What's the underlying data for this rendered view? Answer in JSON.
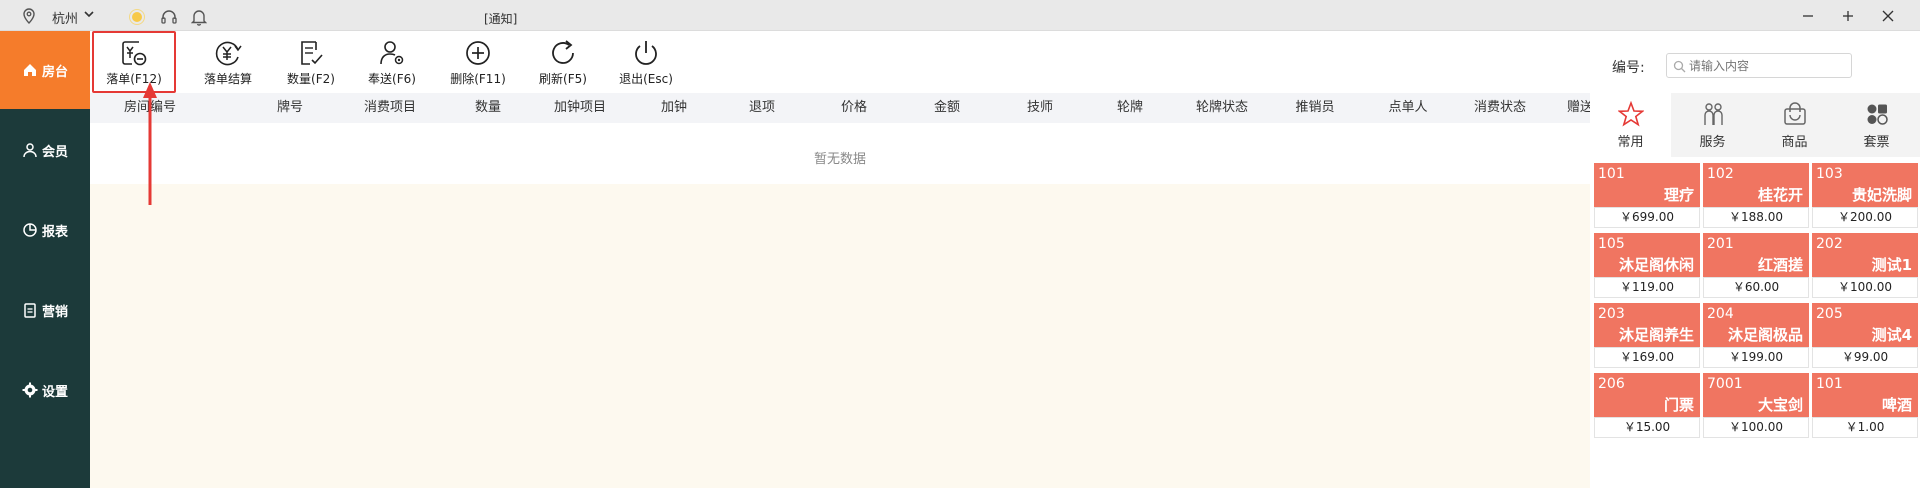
{
  "titlebar": {
    "city": "杭州",
    "notice": "[通知]"
  },
  "sidebar": {
    "items": [
      {
        "label": "房台",
        "icon": "home-icon",
        "active": true
      },
      {
        "label": "会员",
        "icon": "user-icon",
        "active": false
      },
      {
        "label": "报表",
        "icon": "pie-chart-icon",
        "active": false
      },
      {
        "label": "营销",
        "icon": "clipboard-icon",
        "active": false
      },
      {
        "label": "设置",
        "icon": "gear-icon",
        "active": false
      }
    ]
  },
  "toolbar": {
    "buttons": [
      {
        "label": "落单(F12)",
        "icon": "yen-minus-icon",
        "selected": true
      },
      {
        "label": "落单结算",
        "icon": "yen-refresh-icon",
        "selected": false
      },
      {
        "label": "数量(F2)",
        "icon": "edit-doc-icon",
        "selected": false
      },
      {
        "label": "奉送(F6)",
        "icon": "user-gear-icon",
        "selected": false
      },
      {
        "label": "删除(F11)",
        "icon": "plus-circle-icon",
        "selected": false
      },
      {
        "label": "刷新(F5)",
        "icon": "refresh-icon",
        "selected": false
      },
      {
        "label": "退出(Esc)",
        "icon": "power-icon",
        "selected": false
      }
    ],
    "code_label": "编号:",
    "search_placeholder": "请输入内容"
  },
  "table": {
    "headers": [
      "房间编号",
      "牌号",
      "消费项目",
      "数量",
      "加钟项目",
      "加钟",
      "退项",
      "价格",
      "金额",
      "技师",
      "轮牌",
      "轮牌状态",
      "推销员",
      "点单人",
      "消费状态",
      "赠送"
    ],
    "empty_text": "暂无数据"
  },
  "categories": [
    {
      "label": "常用",
      "icon": "star-icon",
      "active": true
    },
    {
      "label": "服务",
      "icon": "people-icon",
      "active": false
    },
    {
      "label": "商品",
      "icon": "shopping-bag-icon",
      "active": false
    },
    {
      "label": "套票",
      "icon": "package-icon",
      "active": false
    }
  ],
  "products": [
    {
      "code": "101",
      "name": "理疗",
      "price": "￥699.00"
    },
    {
      "code": "102",
      "name": "桂花开",
      "price": "￥188.00"
    },
    {
      "code": "103",
      "name": "贵妃洗脚",
      "price": "￥200.00"
    },
    {
      "code": "105",
      "name": "沐足阁休闲",
      "price": "￥119.00"
    },
    {
      "code": "201",
      "name": "红酒搓",
      "price": "￥60.00"
    },
    {
      "code": "202",
      "name": "测试1",
      "price": "￥100.00"
    },
    {
      "code": "203",
      "name": "沐足阁养生",
      "price": "￥169.00"
    },
    {
      "code": "204",
      "name": "沐足阁极品",
      "price": "￥199.00"
    },
    {
      "code": "205",
      "name": "测试4",
      "price": "￥99.00"
    },
    {
      "code": "206",
      "name": "门票",
      "price": "￥15.00"
    },
    {
      "code": "7001",
      "name": "大宝剑",
      "price": "￥100.00"
    },
    {
      "code": "101",
      "name": "啤酒",
      "price": "￥1.00"
    }
  ],
  "colors": {
    "sidebar_bg": "#1c3a3a",
    "sidebar_active": "#f57c2b",
    "card_bg": "#f07561",
    "annotation_red": "#e53935"
  }
}
